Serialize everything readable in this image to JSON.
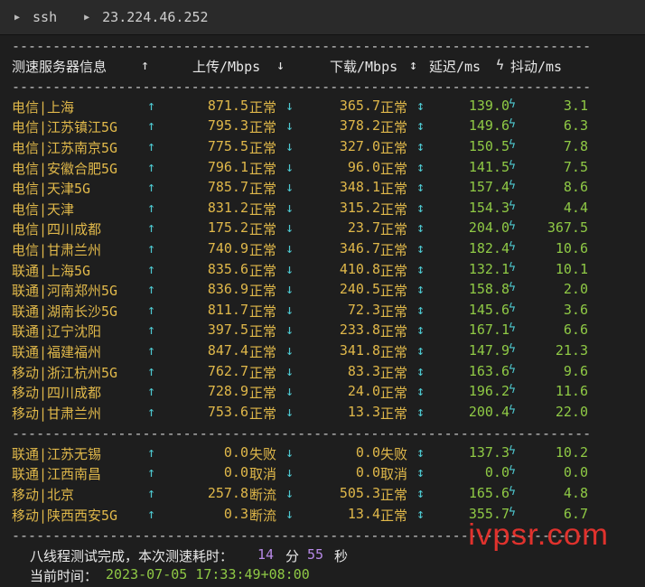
{
  "tab": {
    "items": [
      "ssh",
      "23.224.46.252"
    ]
  },
  "separator": "-----------------------------------------------------------------------",
  "header": {
    "server": "测速服务器信息",
    "server_arrow": "↑",
    "upload": "上传/Mbps",
    "upload_arrow": "↓",
    "download": "下载/Mbps",
    "download_arrow": "↕",
    "latency": "延迟/ms",
    "jitter_icon": "ϟ",
    "jitter": "抖动/ms"
  },
  "rows_group1": [
    {
      "loc": "电信|上海",
      "up": "871.5",
      "up_status": "正常",
      "down": "365.7",
      "down_status": "正常",
      "lat": "139.0",
      "jit": "3.1"
    },
    {
      "loc": "电信|江苏镇江5G",
      "up": "795.3",
      "up_status": "正常",
      "down": "378.2",
      "down_status": "正常",
      "lat": "149.6",
      "jit": "6.3"
    },
    {
      "loc": "电信|江苏南京5G",
      "up": "775.5",
      "up_status": "正常",
      "down": "327.0",
      "down_status": "正常",
      "lat": "150.5",
      "jit": "7.8"
    },
    {
      "loc": "电信|安徽合肥5G",
      "up": "796.1",
      "up_status": "正常",
      "down": "96.0",
      "down_status": "正常",
      "lat": "141.5",
      "jit": "7.5"
    },
    {
      "loc": "电信|天津5G",
      "up": "785.7",
      "up_status": "正常",
      "down": "348.1",
      "down_status": "正常",
      "lat": "157.4",
      "jit": "8.6"
    },
    {
      "loc": "电信|天津",
      "up": "831.2",
      "up_status": "正常",
      "down": "315.2",
      "down_status": "正常",
      "lat": "154.3",
      "jit": "4.4"
    },
    {
      "loc": "电信|四川成都",
      "up": "175.2",
      "up_status": "正常",
      "down": "23.7",
      "down_status": "正常",
      "lat": "204.0",
      "jit": "367.5"
    },
    {
      "loc": "电信|甘肃兰州",
      "up": "740.9",
      "up_status": "正常",
      "down": "346.7",
      "down_status": "正常",
      "lat": "182.4",
      "jit": "10.6"
    },
    {
      "loc": "联通|上海5G",
      "up": "835.6",
      "up_status": "正常",
      "down": "410.8",
      "down_status": "正常",
      "lat": "132.1",
      "jit": "10.1"
    },
    {
      "loc": "联通|河南郑州5G",
      "up": "836.9",
      "up_status": "正常",
      "down": "240.5",
      "down_status": "正常",
      "lat": "158.8",
      "jit": "2.0"
    },
    {
      "loc": "联通|湖南长沙5G",
      "up": "811.7",
      "up_status": "正常",
      "down": "72.3",
      "down_status": "正常",
      "lat": "145.6",
      "jit": "3.6"
    },
    {
      "loc": "联通|辽宁沈阳",
      "up": "397.5",
      "up_status": "正常",
      "down": "233.8",
      "down_status": "正常",
      "lat": "167.1",
      "jit": "6.6"
    },
    {
      "loc": "联通|福建福州",
      "up": "847.4",
      "up_status": "正常",
      "down": "341.8",
      "down_status": "正常",
      "lat": "147.9",
      "jit": "21.3"
    },
    {
      "loc": "移动|浙江杭州5G",
      "up": "762.7",
      "up_status": "正常",
      "down": "83.3",
      "down_status": "正常",
      "lat": "163.6",
      "jit": "9.6"
    },
    {
      "loc": "移动|四川成都",
      "up": "728.9",
      "up_status": "正常",
      "down": "24.0",
      "down_status": "正常",
      "lat": "196.2",
      "jit": "11.6"
    },
    {
      "loc": "移动|甘肃兰州",
      "up": "753.6",
      "up_status": "正常",
      "down": "13.3",
      "down_status": "正常",
      "lat": "200.4",
      "jit": "22.0"
    }
  ],
  "rows_group2": [
    {
      "loc": "联通|江苏无锡",
      "up": "0.0",
      "up_status": "失败",
      "down": "0.0",
      "down_status": "失败",
      "lat": "137.3",
      "jit": "10.2"
    },
    {
      "loc": "联通|江西南昌",
      "up": "0.0",
      "up_status": "取消",
      "down": "0.0",
      "down_status": "取消",
      "lat": "0.0",
      "jit": "0.0"
    },
    {
      "loc": "移动|北京",
      "up": "257.8",
      "up_status": "断流",
      "down": "505.3",
      "down_status": "正常",
      "lat": "165.6",
      "jit": "4.8"
    },
    {
      "loc": "移动|陕西西安5G",
      "up": "0.3",
      "up_status": "断流",
      "down": "13.4",
      "down_status": "正常",
      "lat": "355.7",
      "jit": "6.7"
    }
  ],
  "symbols": {
    "up": "↑",
    "down": "↓",
    "updown": "↕",
    "bolt": "ϟ"
  },
  "summary": {
    "prefix": "八线程测试完成，本次测速耗时：",
    "minutes": "14",
    "min_unit": "分",
    "seconds": "55",
    "sec_unit": "秒",
    "time_label": "当前时间：",
    "time_value": "2023-07-05 17:33:49+08:00"
  },
  "watermark": "ivpsr.com",
  "colors": {
    "background": "#1e1e1e",
    "location": "#e0b84a",
    "arrow": "#4ec9d1",
    "latency": "#8fc945",
    "highlight": "#b88ae8",
    "watermark": "#e0322d"
  }
}
